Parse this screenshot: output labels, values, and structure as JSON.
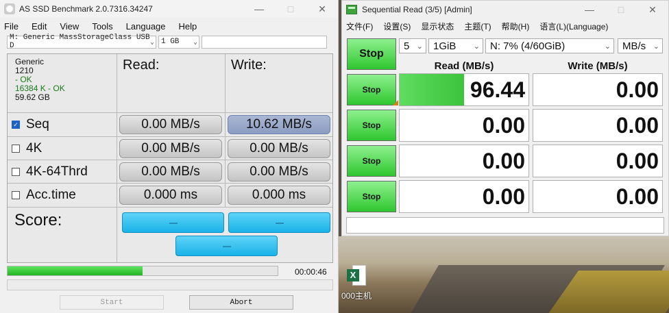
{
  "asssd": {
    "title": "AS SSD Benchmark 2.0.7316.34247",
    "menu": [
      "File",
      "Edit",
      "View",
      "Tools",
      "Language",
      "Help"
    ],
    "drive_select": "M: Generic MassStorageClass USB D",
    "size_select": "1 GB",
    "device": {
      "name": "Generic",
      "fw": "1210",
      "status1": " - OK",
      "status2": "16384 K - OK",
      "capacity": "59.62 GB"
    },
    "headers": {
      "read": "Read:",
      "write": "Write:"
    },
    "rows": [
      {
        "label": "Seq",
        "checked": true,
        "read": "0.00 MB/s",
        "write": "10.62 MB/s"
      },
      {
        "label": "4K",
        "checked": false,
        "read": "0.00 MB/s",
        "write": "0.00 MB/s"
      },
      {
        "label": "4K-64Thrd",
        "checked": false,
        "read": "0.00 MB/s",
        "write": "0.00 MB/s"
      },
      {
        "label": "Acc.time",
        "checked": false,
        "read": "0.000 ms",
        "write": "0.000 ms"
      }
    ],
    "score": {
      "label": "Score:",
      "read": "----",
      "write": "----",
      "total": "----"
    },
    "progress_fraction": 0.5,
    "elapsed": "00:00:46",
    "start_label": "Start",
    "abort_label": "Abort"
  },
  "cdm": {
    "title": "Sequential Read (3/5) [Admin]",
    "menu": [
      "文件(F)",
      "设置(S)",
      "显示状态",
      "主题(T)",
      "帮助(H)",
      "语言(L)(Language)"
    ],
    "all_button": "Stop",
    "count": "5",
    "size": "1GiB",
    "drive": "N: 7% (4/60GiB)",
    "unit": "MB/s",
    "read_header": "Read (MB/s)",
    "write_header": "Write (MB/s)",
    "rows": [
      {
        "button": "Stop",
        "read": "96.44",
        "write": "0.00",
        "read_fill": 0.5
      },
      {
        "button": "Stop",
        "read": "0.00",
        "write": "0.00",
        "read_fill": 0
      },
      {
        "button": "Stop",
        "read": "0.00",
        "write": "0.00",
        "read_fill": 0
      },
      {
        "button": "Stop",
        "read": "0.00",
        "write": "0.00",
        "read_fill": 0
      }
    ]
  },
  "desktop": {
    "icon_label": "000主机",
    "icon_badge": "X"
  },
  "colors": {
    "stop_green": "#2fc62f",
    "score_blue": "#19b3e8",
    "progress_green": "#22b322",
    "write_active_blue": "#8c9dc2"
  }
}
